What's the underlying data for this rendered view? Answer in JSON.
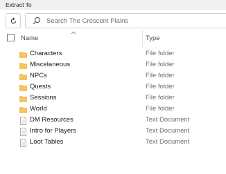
{
  "window": {
    "title": "Extract To"
  },
  "toolbar": {
    "search_placeholder": "Search The Crescent Plains"
  },
  "columns": {
    "name": "Name",
    "type": "Type"
  },
  "items": [
    {
      "name": "Characters",
      "type": "File folder",
      "icon": "folder-icon"
    },
    {
      "name": "Miscelaneous",
      "type": "File folder",
      "icon": "folder-icon"
    },
    {
      "name": "NPCs",
      "type": "File folder",
      "icon": "folder-icon"
    },
    {
      "name": "Quests",
      "type": "File folder",
      "icon": "folder-icon"
    },
    {
      "name": "Sessions",
      "type": "File folder",
      "icon": "folder-icon"
    },
    {
      "name": "World",
      "type": "File folder",
      "icon": "folder-icon"
    },
    {
      "name": "DM Resources",
      "type": "Text Document",
      "icon": "text-document-icon"
    },
    {
      "name": "Intro for Players",
      "type": "Text Document",
      "icon": "text-document-icon"
    },
    {
      "name": "Loot Tables",
      "type": "Text Document",
      "icon": "text-document-icon"
    }
  ],
  "colors": {
    "folder": "#f4c65a",
    "folder_dark": "#e2ab2e",
    "doc_border": "#9a9a9a"
  }
}
